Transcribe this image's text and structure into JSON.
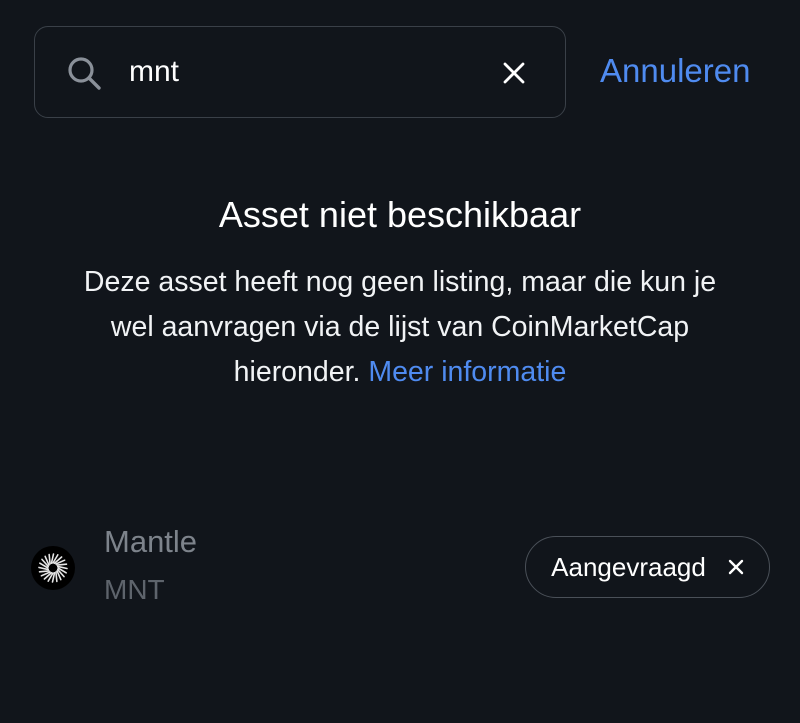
{
  "search": {
    "value": "mnt",
    "icon": "search-icon",
    "clear_icon": "close-icon"
  },
  "cancel_label": "Annuleren",
  "message": {
    "title": "Asset niet beschikbaar",
    "body": "Deze asset heeft nog geen listing, maar die kun je wel aanvragen via de lijst van CoinMarketCap hieronder.",
    "link_label": "Meer informatie"
  },
  "asset": {
    "name": "Mantle",
    "symbol": "MNT",
    "logo_icon": "mantle-logo-icon",
    "status_label": "Aangevraagd",
    "status_icon": "close-icon"
  },
  "colors": {
    "background": "#11151b",
    "accent": "#4f8bf0",
    "border": "#3a4048",
    "muted_text": "#7d838b"
  }
}
